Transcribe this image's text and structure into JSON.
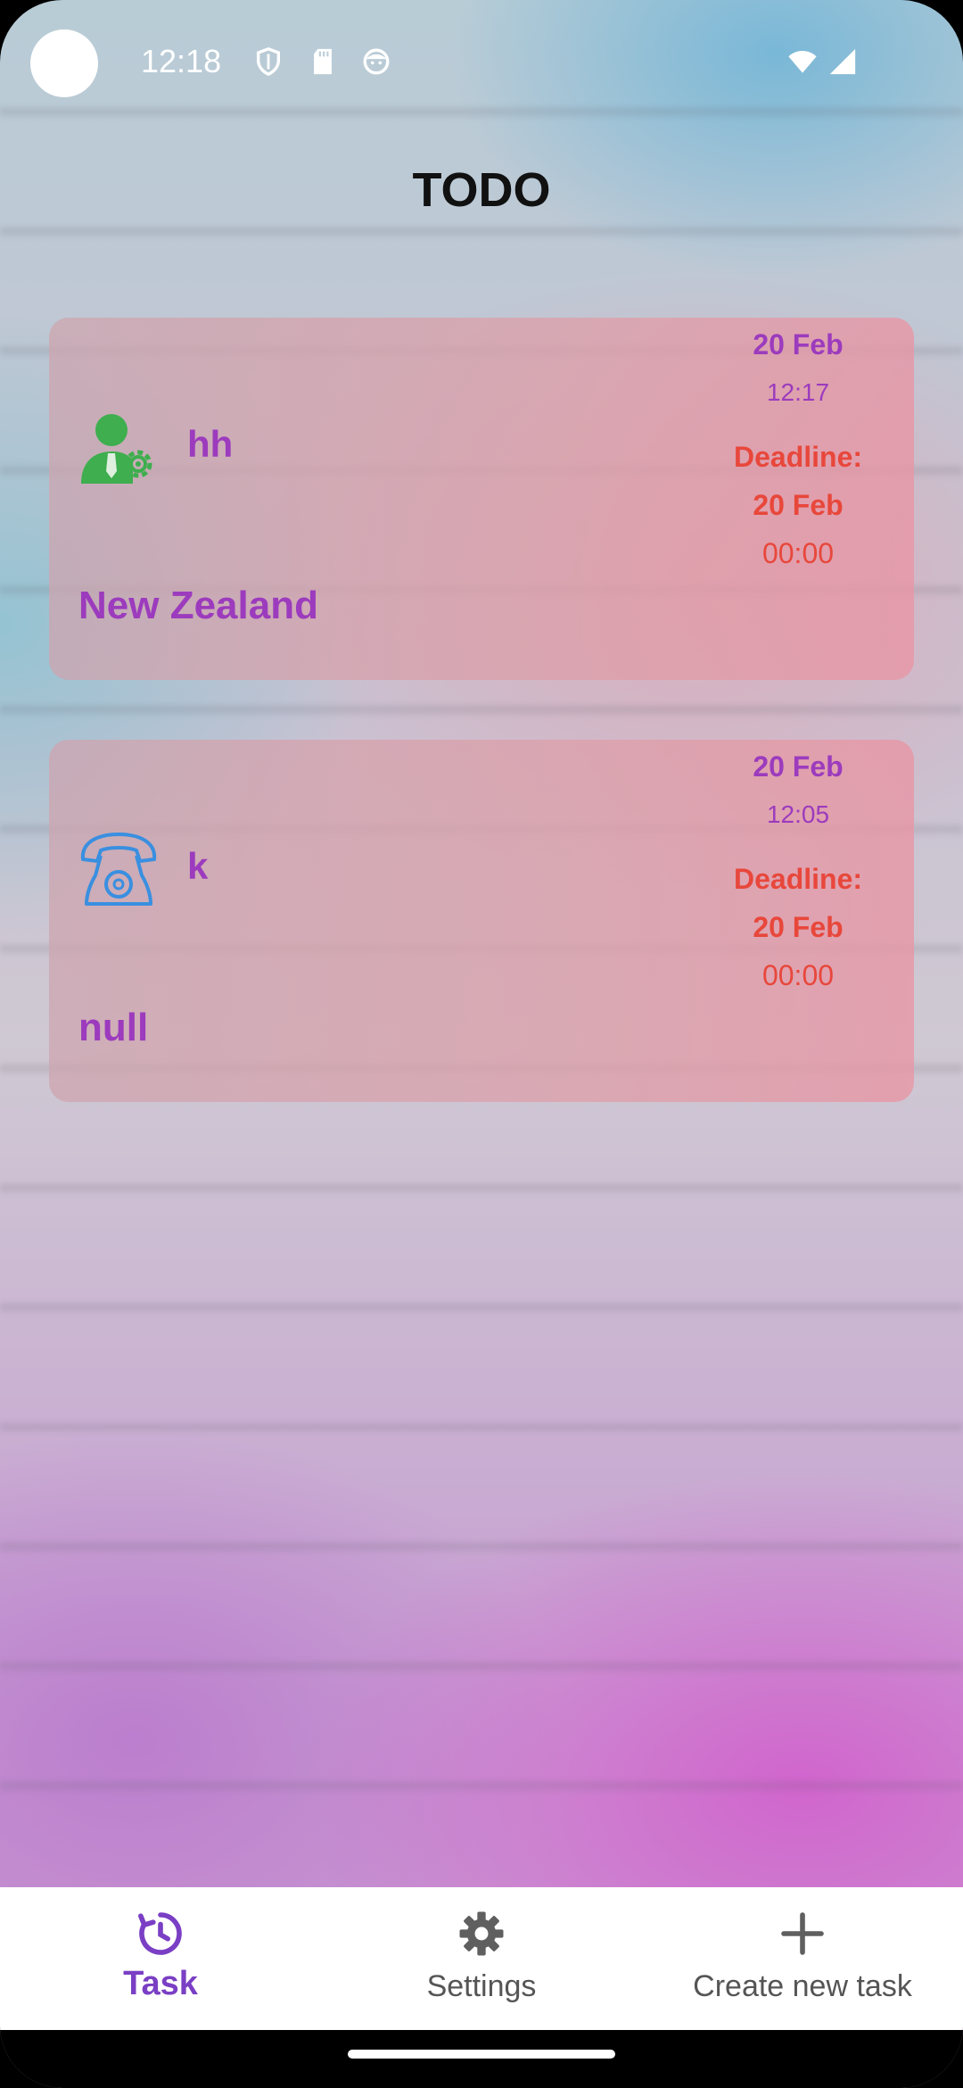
{
  "status_bar": {
    "time": "12:18",
    "icons": [
      "shield-icon",
      "sd-card-icon",
      "face-icon",
      "wifi-icon",
      "cell-signal-icon"
    ]
  },
  "title": "TODO",
  "tasks": [
    {
      "icon": "person-gear-icon",
      "name": "hh",
      "description": "New Zealand",
      "created_date": "20 Feb",
      "created_time": "12:17",
      "deadline_label": "Deadline:",
      "deadline_date": "20 Feb",
      "deadline_time": "00:00"
    },
    {
      "icon": "telephone-icon",
      "name": "k",
      "description": "null",
      "created_date": "20 Feb",
      "created_time": "12:05",
      "deadline_label": "Deadline:",
      "deadline_date": "20 Feb",
      "deadline_time": "00:00"
    }
  ],
  "bottom_nav": {
    "items": [
      {
        "label": "Task",
        "icon": "clock-refresh-icon",
        "active": true
      },
      {
        "label": "Settings",
        "icon": "gear-icon",
        "active": false
      },
      {
        "label": "Create new task",
        "icon": "plus-icon",
        "active": false
      }
    ]
  },
  "colors": {
    "accent": "#9c3bbd",
    "deadline": "#e8473b",
    "nav_active": "#7a3fc4"
  }
}
